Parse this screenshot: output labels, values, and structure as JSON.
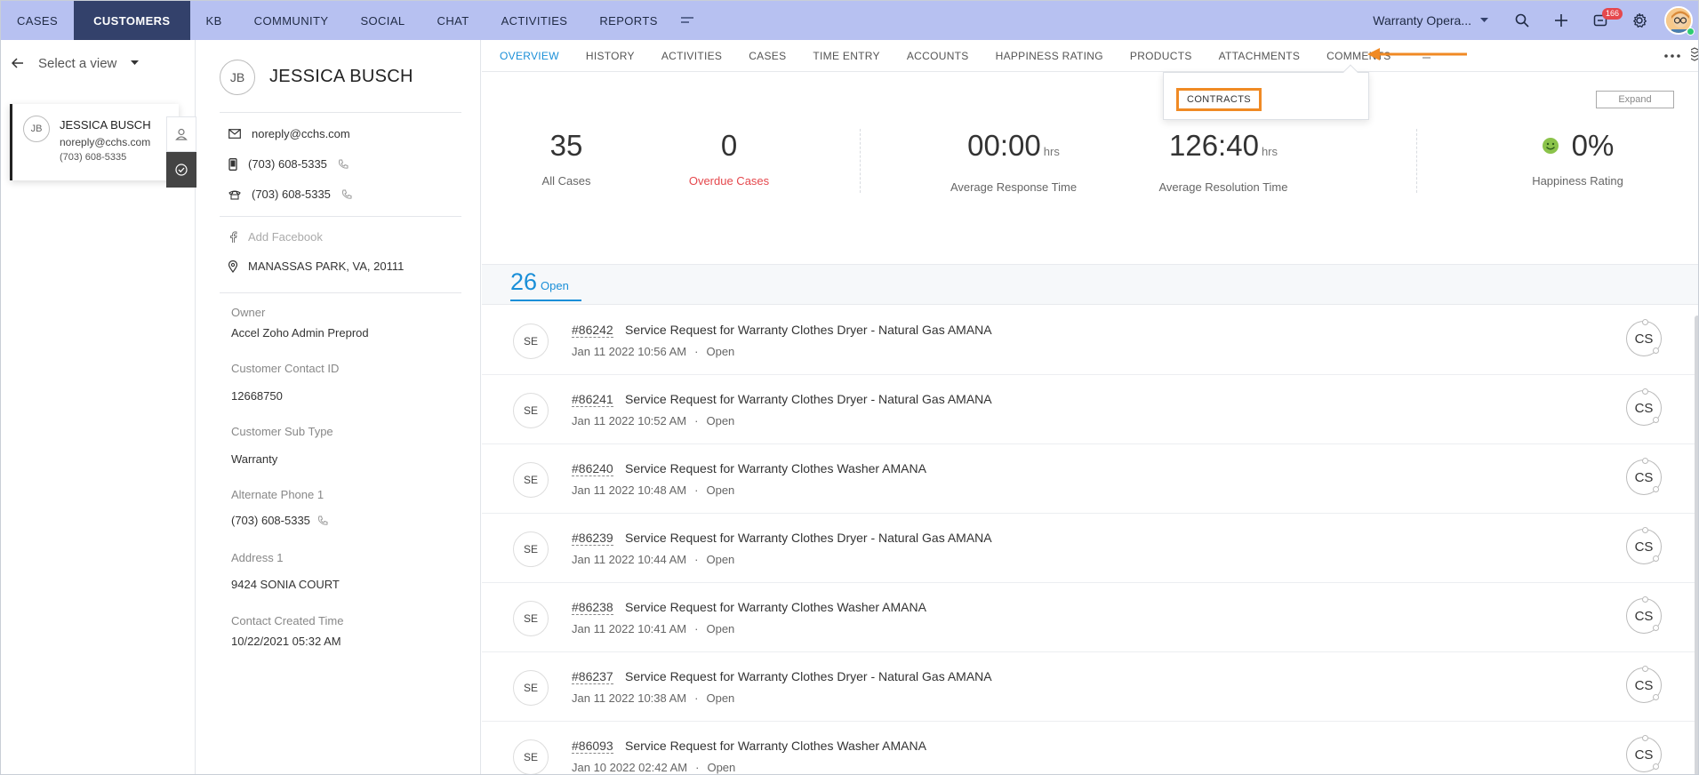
{
  "topnav": {
    "items": [
      "CASES",
      "CUSTOMERS",
      "KB",
      "COMMUNITY",
      "SOCIAL",
      "CHAT",
      "ACTIVITIES",
      "REPORTS"
    ],
    "active_index": 1,
    "department": "Warranty Opera...",
    "notification_count": "166",
    "icons": [
      "search-icon",
      "plus-icon",
      "notification-icon",
      "gear-icon",
      "avatar"
    ]
  },
  "leftpanel": {
    "view_label": "Select a view",
    "card": {
      "initials": "JB",
      "name": "JESSICA BUSCH",
      "email": "noreply@cchs.com",
      "phone": "(703) 608-5335"
    }
  },
  "details": {
    "initials": "JB",
    "name": "JESSICA BUSCH",
    "email": "noreply@cchs.com",
    "phone": "(703) 608-5335",
    "mobile": "(703) 608-5335",
    "facebook_placeholder": "Add Facebook",
    "address": "MANASSAS PARK, VA, 20111",
    "fields": [
      {
        "label": "Owner",
        "value": "Accel Zoho Admin Preprod"
      },
      {
        "label": "Customer Contact ID",
        "value": "12668750"
      },
      {
        "label": "Customer Sub Type",
        "value": "Warranty"
      },
      {
        "label": "Alternate Phone 1",
        "value": "(703) 608-5335"
      },
      {
        "label": "Address 1",
        "value": "9424 SONIA COURT"
      },
      {
        "label": "Contact Created Time",
        "value": "10/22/2021 05:32 AM"
      }
    ]
  },
  "main": {
    "tabs": [
      "OVERVIEW",
      "HISTORY",
      "ACTIVITIES",
      "CASES",
      "TIME ENTRY",
      "ACCOUNTS",
      "HAPPINESS RATING",
      "PRODUCTS",
      "ATTACHMENTS",
      "COMMENTS"
    ],
    "active_tab": 0,
    "dropdown_item": "CONTRACTS",
    "expand_label": "Expand",
    "arrow_color": "#f08a24",
    "stats": {
      "all_cases": {
        "value": "35",
        "label": "All Cases"
      },
      "overdue_cases": {
        "value": "0",
        "label": "Overdue Cases"
      },
      "avg_response": {
        "value": "00:00",
        "unit": "hrs",
        "label": "Average Response Time"
      },
      "avg_resolution": {
        "value": "126:40",
        "unit": "hrs",
        "label": "Average Resolution Time"
      },
      "happiness": {
        "value": "0%",
        "label": "Happiness Rating"
      }
    },
    "open": {
      "count": "26",
      "label": "Open"
    },
    "tickets": [
      {
        "initials": "SE",
        "id": "#86242",
        "subject": "Service Request for Warranty Clothes Dryer - Natural Gas AMANA",
        "time": "Jan 11 2022 10:56 AM",
        "status": "Open",
        "agent": "CS"
      },
      {
        "initials": "SE",
        "id": "#86241",
        "subject": "Service Request for Warranty Clothes Dryer - Natural Gas AMANA",
        "time": "Jan 11 2022 10:52 AM",
        "status": "Open",
        "agent": "CS"
      },
      {
        "initials": "SE",
        "id": "#86240",
        "subject": "Service Request for Warranty Clothes Washer AMANA",
        "time": "Jan 11 2022 10:48 AM",
        "status": "Open",
        "agent": "CS"
      },
      {
        "initials": "SE",
        "id": "#86239",
        "subject": "Service Request for Warranty Clothes Dryer - Natural Gas AMANA",
        "time": "Jan 11 2022 10:44 AM",
        "status": "Open",
        "agent": "CS"
      },
      {
        "initials": "SE",
        "id": "#86238",
        "subject": "Service Request for Warranty Clothes Washer AMANA",
        "time": "Jan 11 2022 10:41 AM",
        "status": "Open",
        "agent": "CS"
      },
      {
        "initials": "SE",
        "id": "#86237",
        "subject": "Service Request for Warranty Clothes Dryer - Natural Gas AMANA",
        "time": "Jan 11 2022 10:38 AM",
        "status": "Open",
        "agent": "CS"
      },
      {
        "initials": "SE",
        "id": "#86093",
        "subject": "Service Request for Warranty Clothes Washer AMANA",
        "time": "Jan 10 2022 02:42 AM",
        "status": "Open",
        "agent": "CS"
      }
    ]
  }
}
